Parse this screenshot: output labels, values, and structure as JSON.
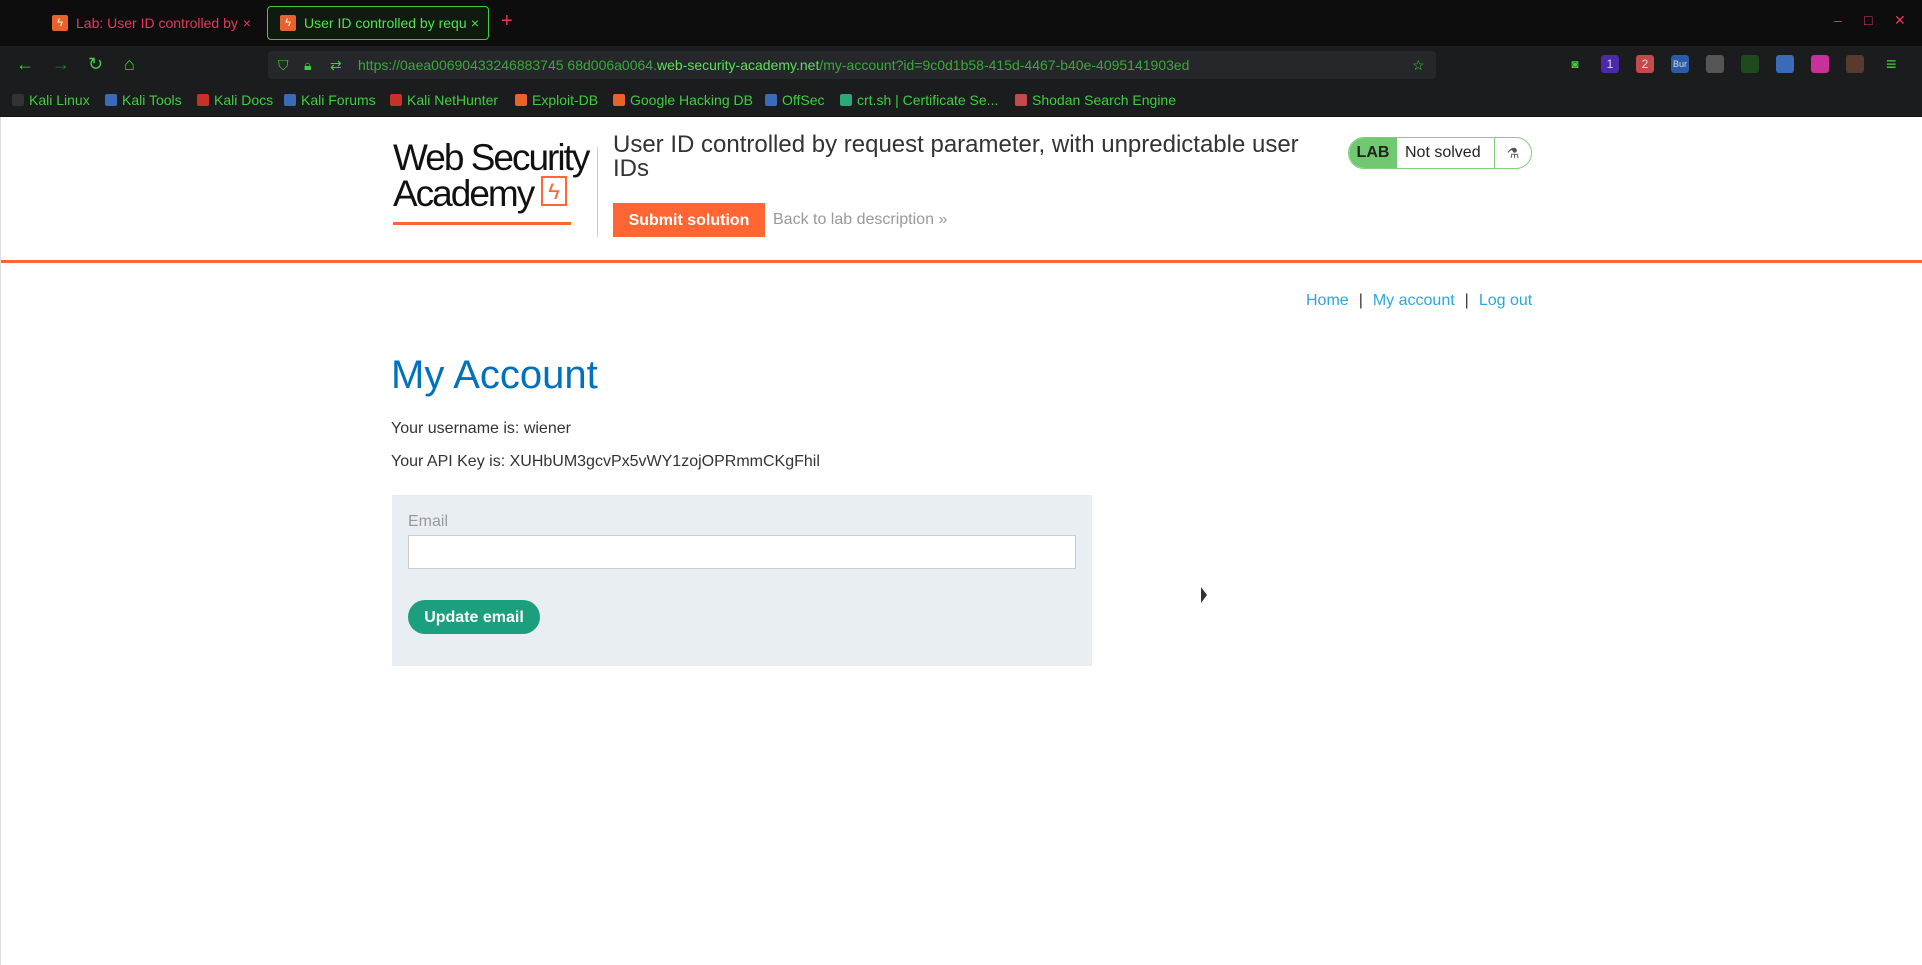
{
  "browser": {
    "tabs": [
      {
        "title": "Lab: User ID controlled by",
        "close": "×"
      },
      {
        "title": "User ID controlled by requ",
        "close": "×"
      }
    ],
    "new_tab": "+",
    "window_controls": {
      "minimize": "–",
      "maximize": "□",
      "close": "✕"
    },
    "url": {
      "prefix": "https://0aea00690433246883745 68d006a0064.",
      "domain": "web-security-academy.net",
      "path": "/my-account?id=9c0d1b58-415d-4467-b40e-4095141903ed"
    },
    "bookmarks": [
      "Kali Linux",
      "Kali Tools",
      "Kali Docs",
      "Kali Forums",
      "Kali NetHunter",
      "Exploit-DB",
      "Google Hacking DB",
      "OffSec",
      "crt.sh | Certificate Se...",
      "Shodan Search Engine"
    ],
    "extension_badges": {
      "ext1": "1",
      "ext2": "2",
      "ext3": "Bur"
    }
  },
  "header": {
    "logo_line1": "Web Security",
    "logo_line2": "Academy",
    "lab_title": "User ID controlled by request parameter, with unpredictable user IDs",
    "submit_label": "Submit solution",
    "back_label": "Back to lab description",
    "back_arrow": "»",
    "badge_lab": "LAB",
    "badge_status": "Not solved"
  },
  "nav": {
    "home": "Home",
    "sep": "|",
    "my_account": "My account",
    "logout": "Log out"
  },
  "main": {
    "title": "My Account",
    "username_line": "Your username is: wiener",
    "api_key_line": "Your API Key is: XUHbUM3gcvPx5vWY1zojOPRmmCKgFhil",
    "email_label": "Email",
    "email_value": "",
    "update_label": "Update email"
  },
  "colors": {
    "accent": "#ff6633",
    "link": "#29a8e0",
    "heading": "#0071bc",
    "button": "#1b9f7e",
    "browser_green": "#3ecf3e"
  }
}
